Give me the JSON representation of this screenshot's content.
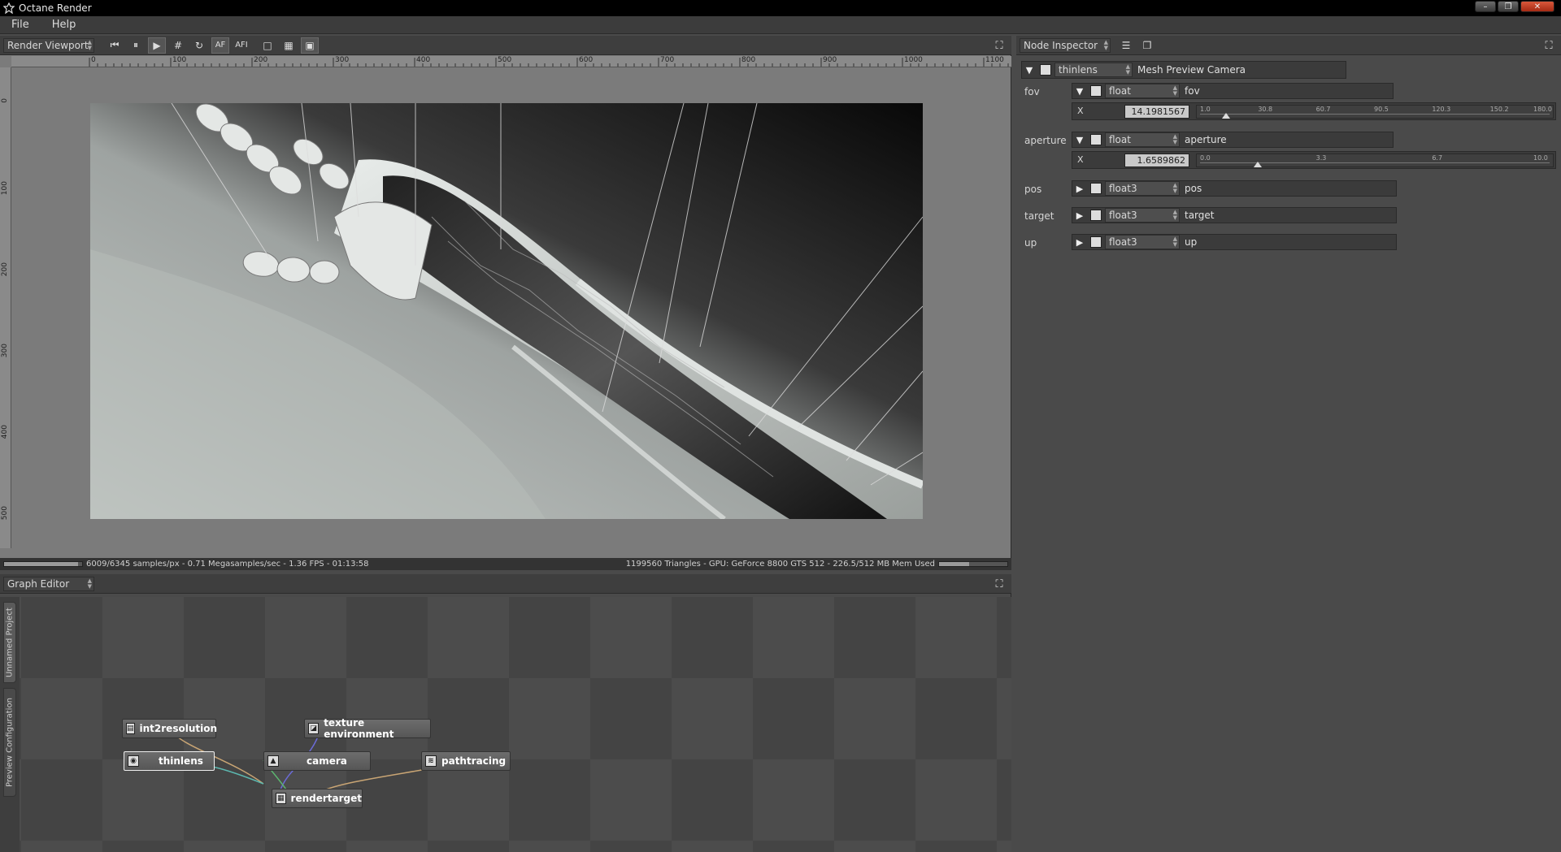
{
  "window": {
    "title": "Octane Render"
  },
  "menu": {
    "file": "File",
    "help": "Help"
  },
  "render_viewport": {
    "dropdown": "Render Viewport",
    "toolbar": {
      "af": "AF",
      "afi": "AFI"
    },
    "ruler_top": [
      "0",
      "100",
      "200",
      "300",
      "400",
      "500",
      "600",
      "700",
      "800",
      "900",
      "1000",
      "1100"
    ],
    "ruler_left": [
      "0",
      "100",
      "200",
      "300",
      "400",
      "500"
    ],
    "status_left": "6009/6345 samples/px - 0.71 Megasamples/sec - 1.36 FPS - 01:13:58",
    "status_right": "1199560 Triangles - GPU: GeForce 8800 GTS 512 - 226.5/512 MB Mem Used",
    "samples_progress": 0.947,
    "mem_progress": 0.442
  },
  "graph_editor": {
    "dropdown": "Graph Editor",
    "side_tabs": [
      "Unnamed Project",
      "Preview Configuration"
    ],
    "nodes": {
      "int2resolution": "int2resolution",
      "texture_environment": "texture environment",
      "thinlens": "thinlens",
      "camera": "camera",
      "pathtracing": "pathtracing",
      "rendertarget": "rendertarget"
    }
  },
  "node_inspector": {
    "dropdown": "Node Inspector",
    "node_type": "thinlens",
    "node_name": "Mesh Preview Camera",
    "params": {
      "fov": {
        "label": "fov",
        "type": "float",
        "name": "fov",
        "axis": "X",
        "value": "14.1981567",
        "ticks": [
          "1.0",
          "30.8",
          "60.7",
          "90.5",
          "120.3",
          "150.2",
          "180.0"
        ],
        "slider_pos": 0.074
      },
      "aperture": {
        "label": "aperture",
        "type": "float",
        "name": "aperture",
        "axis": "X",
        "value": "1.6589862",
        "ticks": [
          "0.0",
          "3.3",
          "6.7",
          "10.0"
        ],
        "slider_pos": 0.166
      },
      "pos": {
        "label": "pos",
        "type": "float3",
        "name": "pos"
      },
      "target": {
        "label": "target",
        "type": "float3",
        "name": "target"
      },
      "up": {
        "label": "up",
        "type": "float3",
        "name": "up"
      }
    }
  }
}
